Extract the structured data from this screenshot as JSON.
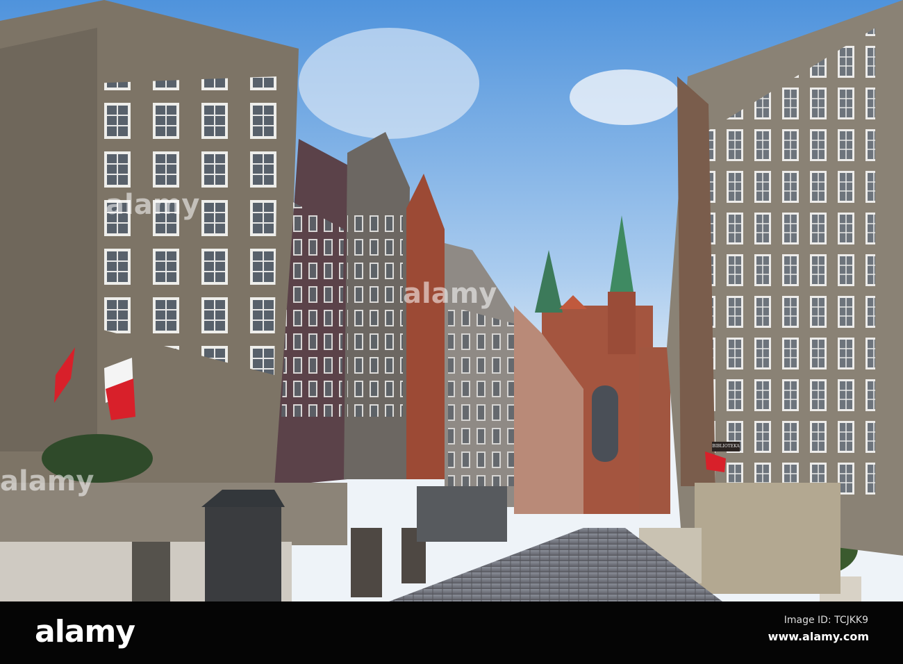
{
  "photo": {
    "sign_text": "BIBLIOTEKA",
    "watermark": "alamy",
    "colors": {
      "sky_top": "#4f93dc",
      "sky_bottom": "#eaf1f8",
      "brick": "#a4553f",
      "stone": "#7d7466"
    }
  },
  "footer": {
    "logo": "alamy",
    "image_id": "Image ID: TCJKK9",
    "url": "www.alamy.com"
  }
}
